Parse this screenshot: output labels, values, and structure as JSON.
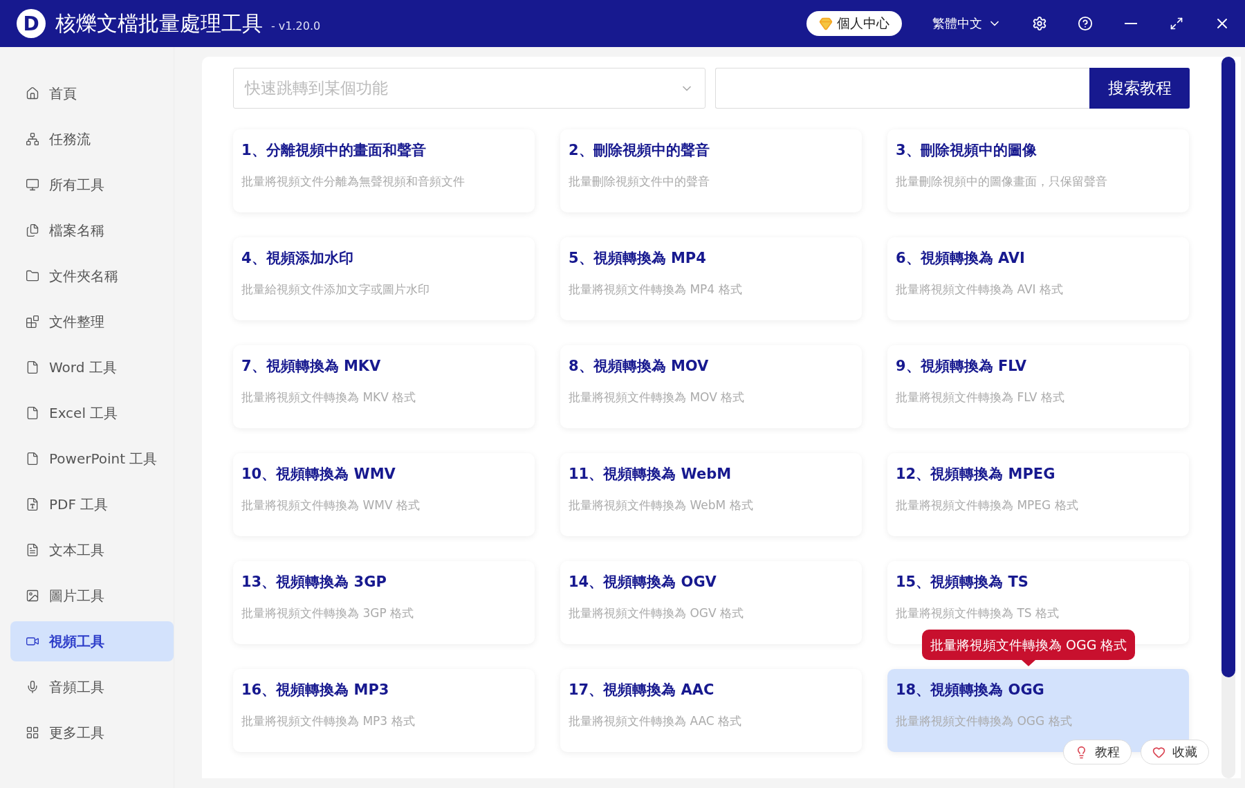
{
  "app": {
    "logo": "D",
    "title": "核爍文檔批量處理工具",
    "version": "- v1.20.0"
  },
  "header": {
    "account": "個人中心",
    "language": "繁體中文"
  },
  "sidebar": {
    "items": [
      {
        "label": "首頁",
        "selected": false
      },
      {
        "label": "任務流",
        "selected": false
      },
      {
        "label": "所有工具",
        "selected": false
      },
      {
        "label": "檔案名稱",
        "selected": false
      },
      {
        "label": "文件夾名稱",
        "selected": false
      },
      {
        "label": "文件整理",
        "selected": false
      },
      {
        "label": "Word 工具",
        "selected": false
      },
      {
        "label": "Excel 工具",
        "selected": false
      },
      {
        "label": "PowerPoint 工具",
        "selected": false
      },
      {
        "label": "PDF 工具",
        "selected": false
      },
      {
        "label": "文本工具",
        "selected": false
      },
      {
        "label": "圖片工具",
        "selected": false
      },
      {
        "label": "視頻工具",
        "selected": true
      },
      {
        "label": "音頻工具",
        "selected": false
      },
      {
        "label": "更多工具",
        "selected": false
      }
    ]
  },
  "search": {
    "placeholder": "快速跳轉到某個功能",
    "button": "搜索教程"
  },
  "tools": [
    {
      "title": "1、分離視頻中的畫面和聲音",
      "description": "批量將視頻文件分離為無聲視頻和音頻文件",
      "hovered": false
    },
    {
      "title": "2、刪除視頻中的聲音",
      "description": "批量刪除視頻文件中的聲音",
      "hovered": false
    },
    {
      "title": "3、刪除視頻中的圖像",
      "description": "批量刪除視頻中的圖像畫面，只保留聲音",
      "hovered": false
    },
    {
      "title": "4、視頻添加水印",
      "description": "批量給視頻文件添加文字或圖片水印",
      "hovered": false
    },
    {
      "title": "5、視頻轉換為 MP4",
      "description": "批量將視頻文件轉換為 MP4 格式",
      "hovered": false
    },
    {
      "title": "6、視頻轉換為 AVI",
      "description": "批量將視頻文件轉換為 AVI 格式",
      "hovered": false
    },
    {
      "title": "7、視頻轉換為 MKV",
      "description": "批量將視頻文件轉換為 MKV 格式",
      "hovered": false
    },
    {
      "title": "8、視頻轉換為 MOV",
      "description": "批量將視頻文件轉換為 MOV 格式",
      "hovered": false
    },
    {
      "title": "9、視頻轉換為 FLV",
      "description": "批量將視頻文件轉換為 FLV 格式",
      "hovered": false
    },
    {
      "title": "10、視頻轉換為 WMV",
      "description": "批量將視頻文件轉換為 WMV 格式",
      "hovered": false
    },
    {
      "title": "11、視頻轉換為 WebM",
      "description": "批量將視頻文件轉換為 WebM 格式",
      "hovered": false
    },
    {
      "title": "12、視頻轉換為 MPEG",
      "description": "批量將視頻文件轉換為 MPEG 格式",
      "hovered": false
    },
    {
      "title": "13、視頻轉換為 3GP",
      "description": "批量將視頻文件轉換為 3GP 格式",
      "hovered": false
    },
    {
      "title": "14、視頻轉換為 OGV",
      "description": "批量將視頻文件轉換為 OGV 格式",
      "hovered": false
    },
    {
      "title": "15、視頻轉換為 TS",
      "description": "批量將視頻文件轉換為 TS 格式",
      "hovered": false
    },
    {
      "title": "16、視頻轉換為 MP3",
      "description": "批量將視頻文件轉換為 MP3 格式",
      "hovered": false
    },
    {
      "title": "17、視頻轉換為 AAC",
      "description": "批量將視頻文件轉換為 AAC 格式",
      "hovered": false
    },
    {
      "title": "18、視頻轉換為 OGG",
      "description": "批量將視頻文件轉換為 OGG 格式",
      "hovered": true
    }
  ],
  "hover_tooltip": "批量將視頻文件轉換為 OGG 格式",
  "card_actions": [
    "教程",
    "收藏"
  ]
}
